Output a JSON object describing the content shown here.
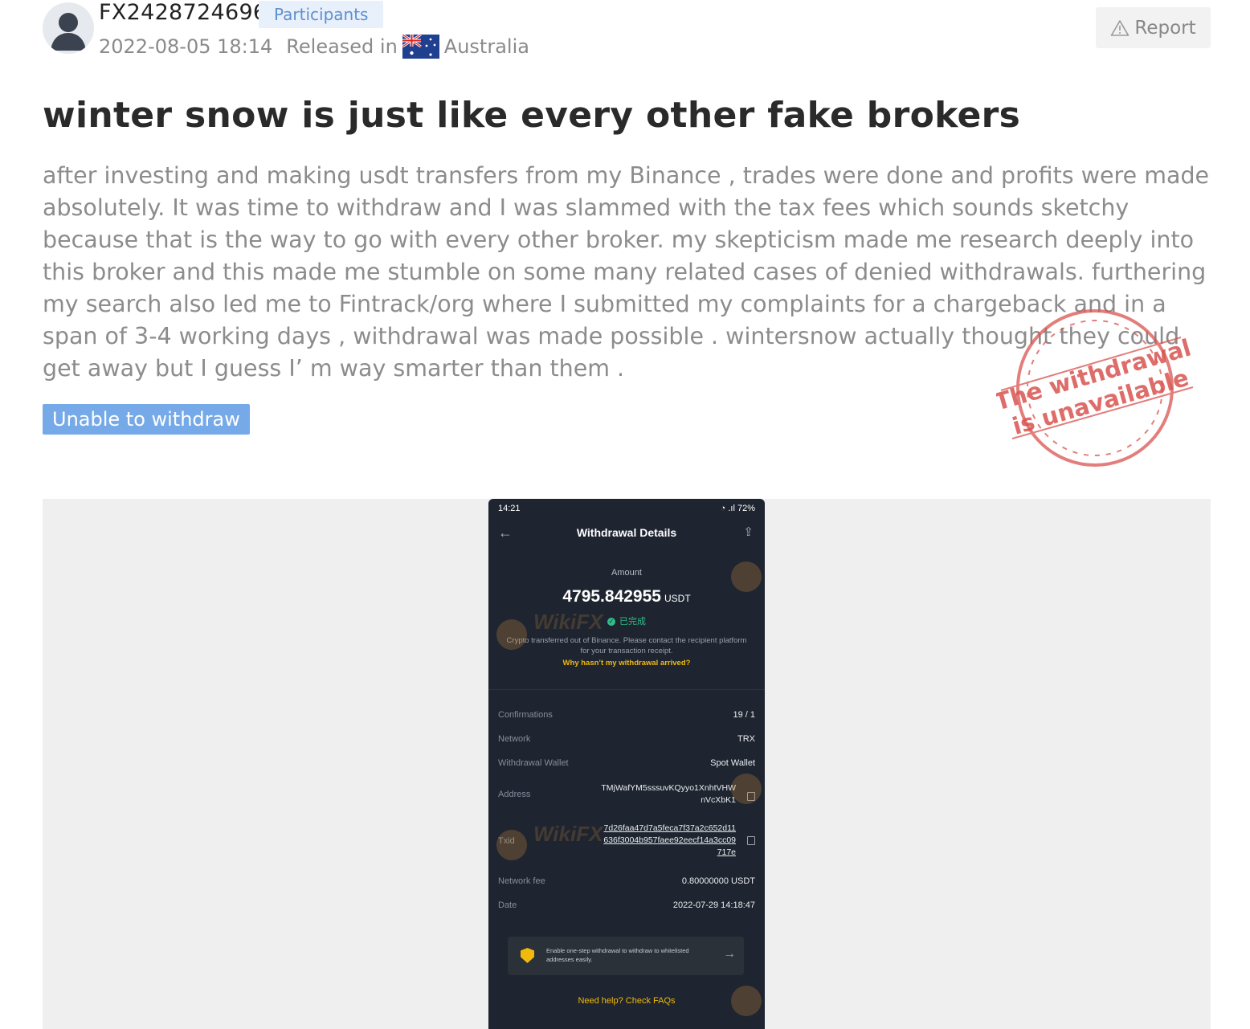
{
  "post": {
    "username": "FX2428724696",
    "role_badge": "Participants",
    "date": "2022-08-05 18:14",
    "released_in": "Released in",
    "country": "Australia",
    "report_label": "Report",
    "title": "winter snow is just like every other fake brokers",
    "body": "after investing and making usdt transfers from my Binance , trades were done and profits were made absolutely. It was time to withdraw and I was slammed with the tax fees which sounds sketchy because that is the way to go with every other broker. my skepticism made me research deeply into this broker and this made me stumble on some many related cases of denied withdrawals. furthering my search also led me to Fintrack/org where I submitted my complaints for a chargeback and in a span of 3-4 working days , withdrawal was made possible . wintersnow actually thought they could get away but I guess I’ m way smarter than them .",
    "tag": "Unable to withdraw",
    "stamp_line1": "The withdrawal",
    "stamp_line2": "is unavailable"
  },
  "screenshot": {
    "status_time": "14:21",
    "battery": "72%",
    "title": "Withdrawal Details",
    "amount_label": "Amount",
    "amount": "4795.842955",
    "amount_unit": "USDT",
    "status": "已完成",
    "note": "Crypto transferred out of Binance. Please contact the recipient platform for your transaction receipt.",
    "why_link": "Why hasn’t my withdrawal arrived?",
    "rows": {
      "confirmations": {
        "k": "Confirmations",
        "v": "19 / 1"
      },
      "network": {
        "k": "Network",
        "v": "TRX"
      },
      "wallet": {
        "k": "Withdrawal Wallet",
        "v": "Spot Wallet"
      },
      "address": {
        "k": "Address",
        "v": "TMjWafYM5sssuvKQyyo1XnhtVHWnVcXbK1"
      },
      "txid": {
        "k": "Txid",
        "v": "7d26faa47d7a5feca7f37a2c652d11636f3004b957faee92eecf14a3cc09717e"
      },
      "fee": {
        "k": "Network fee",
        "v": "0.80000000 USDT"
      },
      "date": {
        "k": "Date",
        "v": "2022-07-29 14:18:47"
      }
    },
    "banner": "Enable one-step withdrawal to withdraw to whitelisted addresses easily.",
    "help": "Need help? Check FAQs",
    "watermark": "WikiFX"
  }
}
